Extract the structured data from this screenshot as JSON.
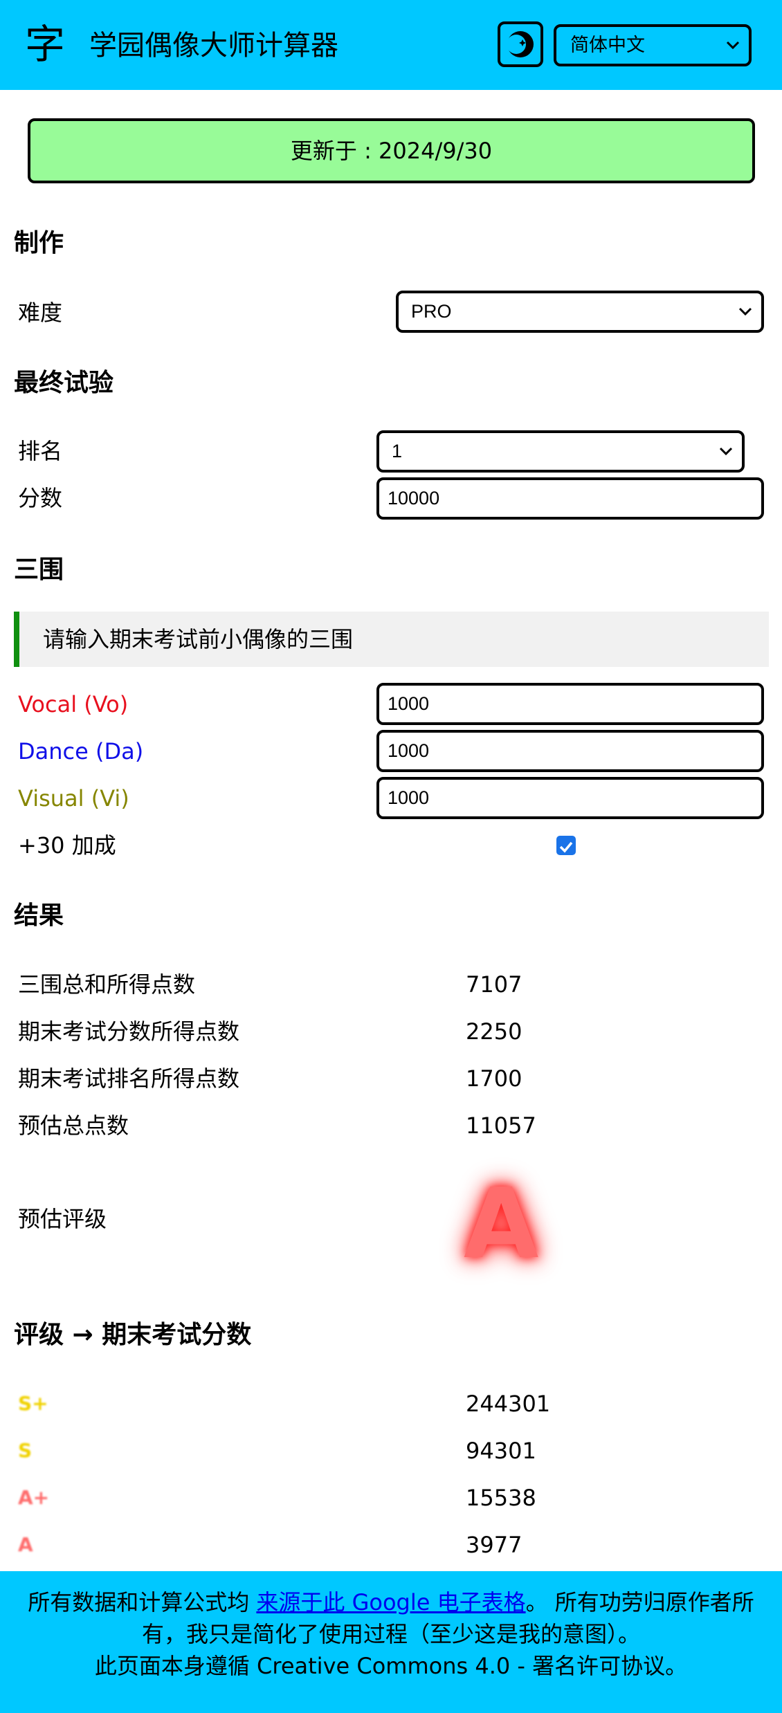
{
  "header": {
    "logo": "字",
    "title": "学园偶像大师计算器",
    "theme_icon": "moon-icon",
    "language": "简体中文"
  },
  "update": "更新于 : 2024/9/30",
  "production": {
    "heading": "制作",
    "difficulty_label": "难度",
    "difficulty_value": "PRO"
  },
  "final_exam": {
    "heading": "最终试验",
    "rank_label": "排名",
    "rank_value": "1",
    "score_label": "分数",
    "score_value": "10000"
  },
  "stats": {
    "heading": "三围",
    "note": "请输入期末考试前小偶像的三围",
    "vocal_label": "Vocal (Vo)",
    "vocal_value": "1000",
    "dance_label": "Dance (Da)",
    "dance_value": "1000",
    "visual_label": "Visual (Vi)",
    "visual_value": "1000",
    "bonus_label": "+30 加成",
    "bonus_checked": true,
    "colors": {
      "vocal": "#e8101e",
      "dance": "#1010e8",
      "visual": "#868600"
    }
  },
  "results": {
    "heading": "结果",
    "rows": [
      {
        "label": "三围总和所得点数",
        "value": "7107"
      },
      {
        "label": "期末考试分数所得点数",
        "value": "2250"
      },
      {
        "label": "期末考试排名所得点数",
        "value": "1700"
      },
      {
        "label": "预估总点数",
        "value": "11057"
      }
    ],
    "grade_label": "预估评级",
    "grade": "A"
  },
  "grade_table": {
    "heading": "评级 → 期末考试分数",
    "rows": [
      {
        "grade": "S+",
        "score": "244301",
        "color": "#f0d200"
      },
      {
        "grade": "S",
        "score": "94301",
        "color": "#f0d200"
      },
      {
        "grade": "A+",
        "score": "15538",
        "color": "#ff6c6c"
      },
      {
        "grade": "A",
        "score": "3977",
        "color": "#ff6c6c"
      }
    ]
  },
  "footer": {
    "text1": "所有数据和计算公式均 ",
    "link": "来源于此 Google 电子表格",
    "text2": "。 所有功劳归原作者所有，我只是简化了使用过程（至少这是我的意图）。",
    "license": "此页面本身遵循 Creative Commons 4.0 - 署名许可协议。"
  }
}
